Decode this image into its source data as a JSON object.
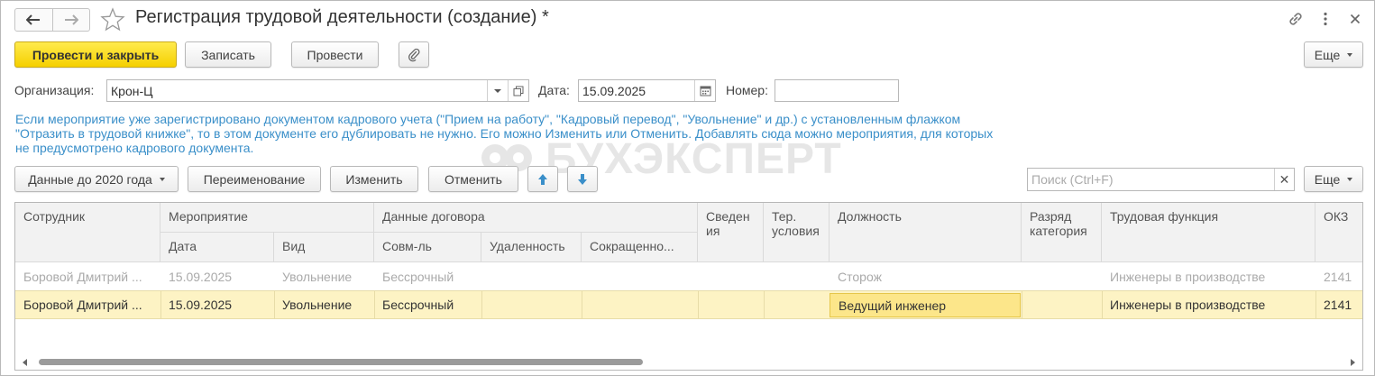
{
  "window": {
    "title": "Регистрация трудовой деятельности (создание) *"
  },
  "toolbar": {
    "post_and_close": "Провести и закрыть",
    "save": "Записать",
    "post": "Провести",
    "more": "Еще"
  },
  "fields": {
    "organization_label": "Организация:",
    "organization_value": "Крон-Ц",
    "date_label": "Дата:",
    "date_value": "15.09.2025",
    "number_label": "Номер:",
    "number_value": ""
  },
  "info": {
    "line1": "Если мероприятие уже зарегистрировано документом кадрового учета (\"Прием на работу\", \"Кадровый перевод\", \"Увольнение\" и др.) с установленным флажком",
    "line2": "\"Отразить в трудовой книжке\", то в этом документе его дублировать не нужно. Его можно Изменить или Отменить. Добавлять сюда можно мероприятия, для которых",
    "line3": "не предусмотрено кадрового документа."
  },
  "watermark": {
    "text": "БУХЭКСПЕРТ"
  },
  "table_toolbar": {
    "before_2020": "Данные до 2020 года",
    "rename": "Переименование",
    "change": "Изменить",
    "cancel": "Отменить",
    "search_placeholder": "Поиск (Ctrl+F)",
    "more": "Еще"
  },
  "grid": {
    "headers": {
      "employee": "Сотрудник",
      "event": "Мероприятие",
      "date": "Дата",
      "kind": "Вид",
      "contract": "Данные договора",
      "combo": "Совм-ль",
      "remote": "Удаленность",
      "reduced": "Сокращенно...",
      "info_l1": "Сведен",
      "info_l2": "ия",
      "terr_l1": "Тер.",
      "terr_l2": "условия",
      "position": "Должность",
      "grade_l1": "Разряд",
      "grade_l2": "категория",
      "function": "Трудовая функция",
      "okz": "ОКЗ"
    },
    "rows": [
      {
        "employee": "Боровой Дмитрий ...",
        "date": "15.09.2025",
        "kind": "Увольнение",
        "combo": "Бессрочный",
        "remote": "",
        "reduced": "",
        "info": "",
        "terr": "",
        "position": "Сторож",
        "grade": "",
        "function": "Инженеры в производстве",
        "okz": "2141"
      },
      {
        "employee": "Боровой Дмитрий ...",
        "date": "15.09.2025",
        "kind": "Увольнение",
        "combo": "Бессрочный",
        "remote": "",
        "reduced": "",
        "info": "",
        "terr": "",
        "position": "Ведущий инженер",
        "grade": "",
        "function": "Инженеры в производстве",
        "okz": "2141"
      }
    ]
  },
  "colors": {
    "primary_button": "#f5d000",
    "info_text": "#3a8fc9",
    "selected_row": "#fdf3c4",
    "focused_cell": "#fce68a",
    "up_down_arrows": "#3a8fc9"
  }
}
